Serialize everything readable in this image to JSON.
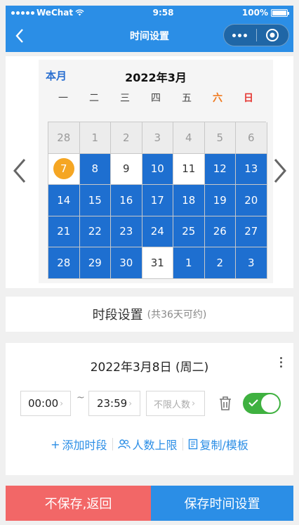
{
  "status_bar": {
    "carrier": "WeChat",
    "time": "9:58",
    "battery": "100%"
  },
  "nav": {
    "title": "时间设置",
    "back_icon": "chevron-left-icon",
    "more_icon": "more-dots-icon",
    "close_icon": "target-icon"
  },
  "calendar": {
    "this_month_label": "本月",
    "title": "2022年3月",
    "weekdays": [
      "一",
      "二",
      "三",
      "四",
      "五",
      "六",
      "日"
    ],
    "cells": [
      {
        "day": "28",
        "kind": "other"
      },
      {
        "day": "1",
        "kind": "other"
      },
      {
        "day": "2",
        "kind": "other"
      },
      {
        "day": "3",
        "kind": "other"
      },
      {
        "day": "4",
        "kind": "other"
      },
      {
        "day": "5",
        "kind": "other"
      },
      {
        "day": "6",
        "kind": "other"
      },
      {
        "day": "7",
        "kind": "today"
      },
      {
        "day": "8",
        "kind": "avail"
      },
      {
        "day": "9",
        "kind": "white"
      },
      {
        "day": "10",
        "kind": "avail"
      },
      {
        "day": "11",
        "kind": "white"
      },
      {
        "day": "12",
        "kind": "avail"
      },
      {
        "day": "13",
        "kind": "avail"
      },
      {
        "day": "14",
        "kind": "avail"
      },
      {
        "day": "15",
        "kind": "avail"
      },
      {
        "day": "16",
        "kind": "avail"
      },
      {
        "day": "17",
        "kind": "avail"
      },
      {
        "day": "18",
        "kind": "avail"
      },
      {
        "day": "19",
        "kind": "avail"
      },
      {
        "day": "20",
        "kind": "avail"
      },
      {
        "day": "21",
        "kind": "avail"
      },
      {
        "day": "22",
        "kind": "avail"
      },
      {
        "day": "23",
        "kind": "avail"
      },
      {
        "day": "24",
        "kind": "avail"
      },
      {
        "day": "25",
        "kind": "avail"
      },
      {
        "day": "26",
        "kind": "avail"
      },
      {
        "day": "27",
        "kind": "avail"
      },
      {
        "day": "28",
        "kind": "avail"
      },
      {
        "day": "29",
        "kind": "avail"
      },
      {
        "day": "30",
        "kind": "avail"
      },
      {
        "day": "31",
        "kind": "white"
      },
      {
        "day": "1",
        "kind": "avail"
      },
      {
        "day": "2",
        "kind": "avail"
      },
      {
        "day": "3",
        "kind": "avail"
      }
    ]
  },
  "period": {
    "title": "时段设置",
    "subtitle": "(共36天可约)"
  },
  "day_setting": {
    "date_label": "2022年3月8日 (周二)",
    "start_time": "00:00",
    "separator": "~",
    "end_time": "23:59",
    "limit_placeholder": "不限人数",
    "toggle_on": true,
    "actions": {
      "add_period": "添加时段",
      "people_limit": "人数上限",
      "copy_template": "复制/模板"
    }
  },
  "footer": {
    "cancel_label": "不保存,返回",
    "save_label": "保存时间设置"
  },
  "colors": {
    "primary": "#2b8ee6",
    "calendar_blue": "#1e6fd0",
    "today": "#f5a623",
    "toggle": "#3fb140",
    "cancel": "#f26767"
  }
}
